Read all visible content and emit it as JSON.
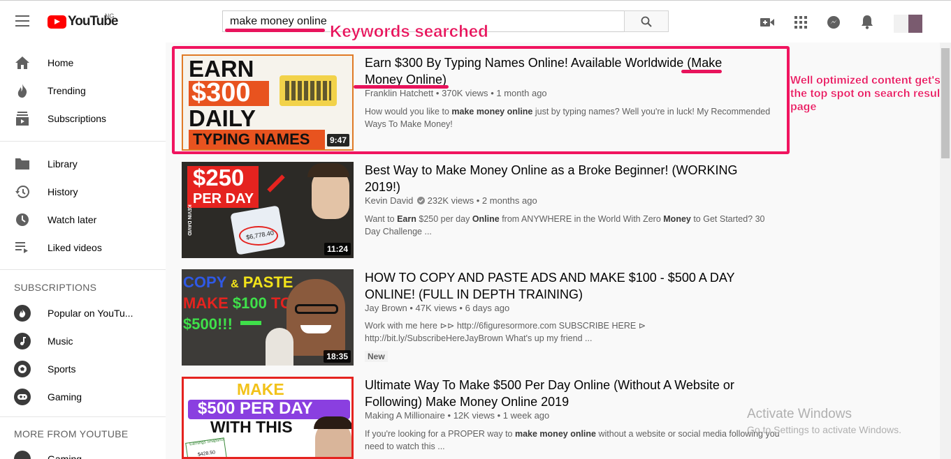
{
  "header": {
    "logo_text": "YouTube",
    "country": "NG",
    "search_value": "make money online",
    "annotation": "Keywords searched"
  },
  "sidebar": {
    "main": [
      {
        "label": "Home",
        "icon": "home-icon"
      },
      {
        "label": "Trending",
        "icon": "flame-icon"
      },
      {
        "label": "Subscriptions",
        "icon": "subscriptions-icon"
      }
    ],
    "library": [
      {
        "label": "Library",
        "icon": "folder-icon"
      },
      {
        "label": "History",
        "icon": "history-icon"
      },
      {
        "label": "Watch later",
        "icon": "clock-icon"
      },
      {
        "label": "Liked videos",
        "icon": "playlist-icon"
      }
    ],
    "subscriptions_heading": "SUBSCRIPTIONS",
    "subscriptions": [
      {
        "label": "Popular on YouTu...",
        "icon": "popular-icon"
      },
      {
        "label": "Music",
        "icon": "music-icon"
      },
      {
        "label": "Sports",
        "icon": "sports-icon"
      },
      {
        "label": "Gaming",
        "icon": "gaming-icon"
      }
    ],
    "more_heading": "MORE FROM YOUTUBE",
    "more": [
      {
        "label": "Gaming",
        "icon": "gaming-icon"
      }
    ]
  },
  "results": [
    {
      "title_a": "Earn $300 By Typing Names Online! Available Worldwide (Make",
      "title_b": "Money Online)",
      "channel": "Franklin Hatchett",
      "views": "370K views",
      "age": "1 month ago",
      "duration": "9:47",
      "desc_parts": [
        "How would you like to ",
        "make money online",
        " just by typing names? Well you're in luck! My Recommended Ways To Make Money!"
      ],
      "thumb": {
        "l1": "EARN",
        "l2": "$300",
        "l3": "DAILY",
        "l4": "TYPING NAMES"
      }
    },
    {
      "title_a": "Best Way to Make Money Online as a Broke Beginner! (WORKING",
      "title_b": "2019!)",
      "channel": "Kevin David",
      "views": "232K views",
      "age": "2 months ago",
      "duration": "11:24",
      "desc_parts": [
        "Want to ",
        "Earn",
        " $250 per day ",
        "Online",
        " from ANYWHERE in the World With Zero ",
        "Money",
        " to Get Started? 30 Day Challenge ..."
      ],
      "thumb": {
        "l1": "$250",
        "l2": "PER DAY",
        "tag": "KEVIN DAVID",
        "amount": "$6,778.40"
      }
    },
    {
      "title_a": "HOW TO COPY AND PASTE ADS AND MAKE $100 - $500 A DAY",
      "title_b": "ONLINE! (FULL IN DEPTH TRAINING)",
      "channel": "Jay Brown",
      "views": "47K views",
      "age": "6 days ago",
      "duration": "18:35",
      "desc_line1": "Work with me here ⊳⊳ http://6figuresormore.com SUBSCRIBE HERE ⊳",
      "desc_line2": "http://bit.ly/SubscribeHereJayBrown What's up my friend ...",
      "badge": "New",
      "thumb": {
        "l1a": "COPY",
        "l1b": "&",
        "l1c": "PASTE",
        "l2a": "MAKE",
        "l2b": "$100",
        "l2c": "TO",
        "l3": "$500!!!"
      }
    },
    {
      "title_a": "Ultimate Way To Make $500 Per Day Online (Without A Website or",
      "title_b": "Following) Make Money Online 2019",
      "channel": "Making A Millionaire",
      "views": "12K views",
      "age": "1 week ago",
      "desc_parts": [
        "If you're looking for a PROPER way to ",
        "make money online",
        " without a website or social media following you need to watch this ..."
      ],
      "thumb": {
        "l1": "MAKE",
        "l2": "$500 PER DAY",
        "l3": "WITH THIS",
        "card": "Earnings Snapshot",
        "card_amt": "$428.50"
      }
    }
  ],
  "annotation_right": "Well optimized content get's the top spot on search result page",
  "watermark": {
    "line1": "Activate Windows",
    "line2": "Go to Settings to activate Windows."
  },
  "separator": "•",
  "colors": {
    "accent": "#e8145c",
    "youtube_red": "#ff0000"
  }
}
